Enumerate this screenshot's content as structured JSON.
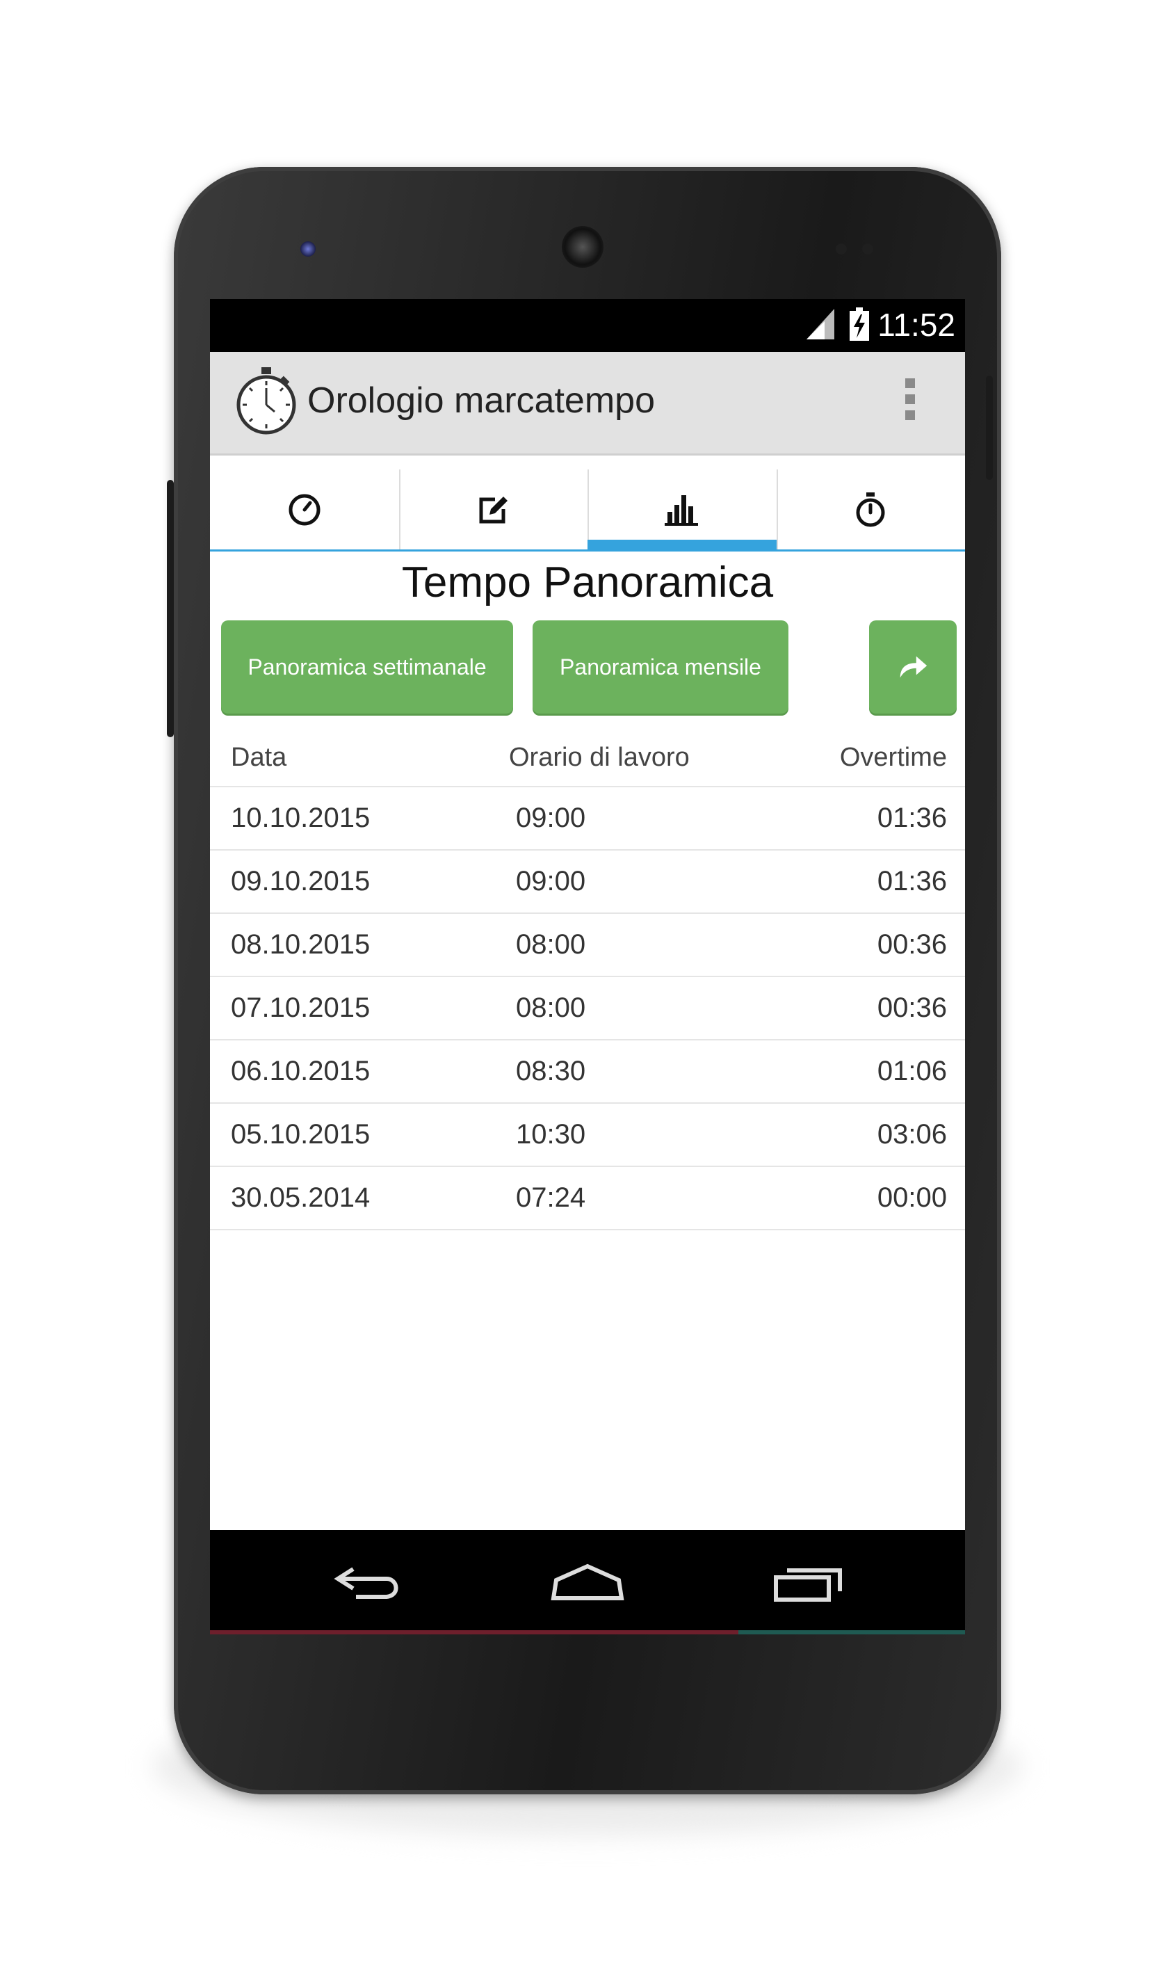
{
  "status_bar": {
    "time": "11:52",
    "signal_icon": "cell-signal-icon",
    "battery_icon": "battery-charging-icon"
  },
  "action_bar": {
    "app_icon": "stopwatch-icon",
    "title": "Orologio marcatempo",
    "overflow_icon": "overflow-menu-icon"
  },
  "tabs": [
    {
      "icon": "clock-icon",
      "active": false
    },
    {
      "icon": "edit-icon",
      "active": false
    },
    {
      "icon": "bar-chart-icon",
      "active": true
    },
    {
      "icon": "stopwatch-icon",
      "active": false
    }
  ],
  "page": {
    "title": "Tempo Panoramica"
  },
  "buttons": {
    "weekly": "Panoramica settimanale",
    "monthly": "Panoramica mensile",
    "share_icon": "share-icon"
  },
  "table": {
    "headers": [
      "Data",
      "Orario di lavoro",
      "Overtime"
    ],
    "rows": [
      [
        "10.10.2015",
        "09:00",
        "01:36"
      ],
      [
        "09.10.2015",
        "09:00",
        "01:36"
      ],
      [
        "08.10.2015",
        "08:00",
        "00:36"
      ],
      [
        "07.10.2015",
        "08:00",
        "00:36"
      ],
      [
        "06.10.2015",
        "08:30",
        "01:06"
      ],
      [
        "05.10.2015",
        "10:30",
        "03:06"
      ],
      [
        "30.05.2014",
        "07:24",
        "00:00"
      ]
    ]
  },
  "nav_bar": {
    "back_icon": "back-icon",
    "home_icon": "home-icon",
    "recents_icon": "recents-icon"
  },
  "colors": {
    "accent": "#35a3dd",
    "button_green": "#6cb25d",
    "action_bar": "#e2e2e2"
  }
}
